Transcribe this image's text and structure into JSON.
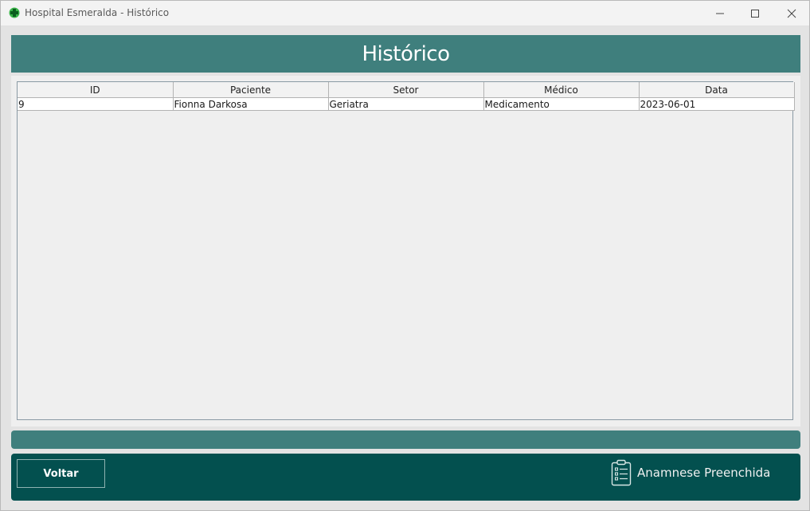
{
  "window": {
    "title": "Hospital Esmeralda - Histórico"
  },
  "header": {
    "title": "Histórico"
  },
  "table": {
    "columns": [
      "ID",
      "Paciente",
      "Setor",
      "Médico",
      "Data"
    ],
    "rows": [
      [
        "9",
        "Fionna Darkosa",
        "Geriatra",
        "Medicamento",
        "2023-06-01"
      ]
    ]
  },
  "footer": {
    "back_label": "Voltar",
    "anamnese_label": "Anamnese Preenchida",
    "anamnese_icon": "clipboard-checklist-icon"
  },
  "colors": {
    "header_bg": "#3f7f7d",
    "footer_bg": "#03504f",
    "app_icon": "#2e9e2e"
  }
}
